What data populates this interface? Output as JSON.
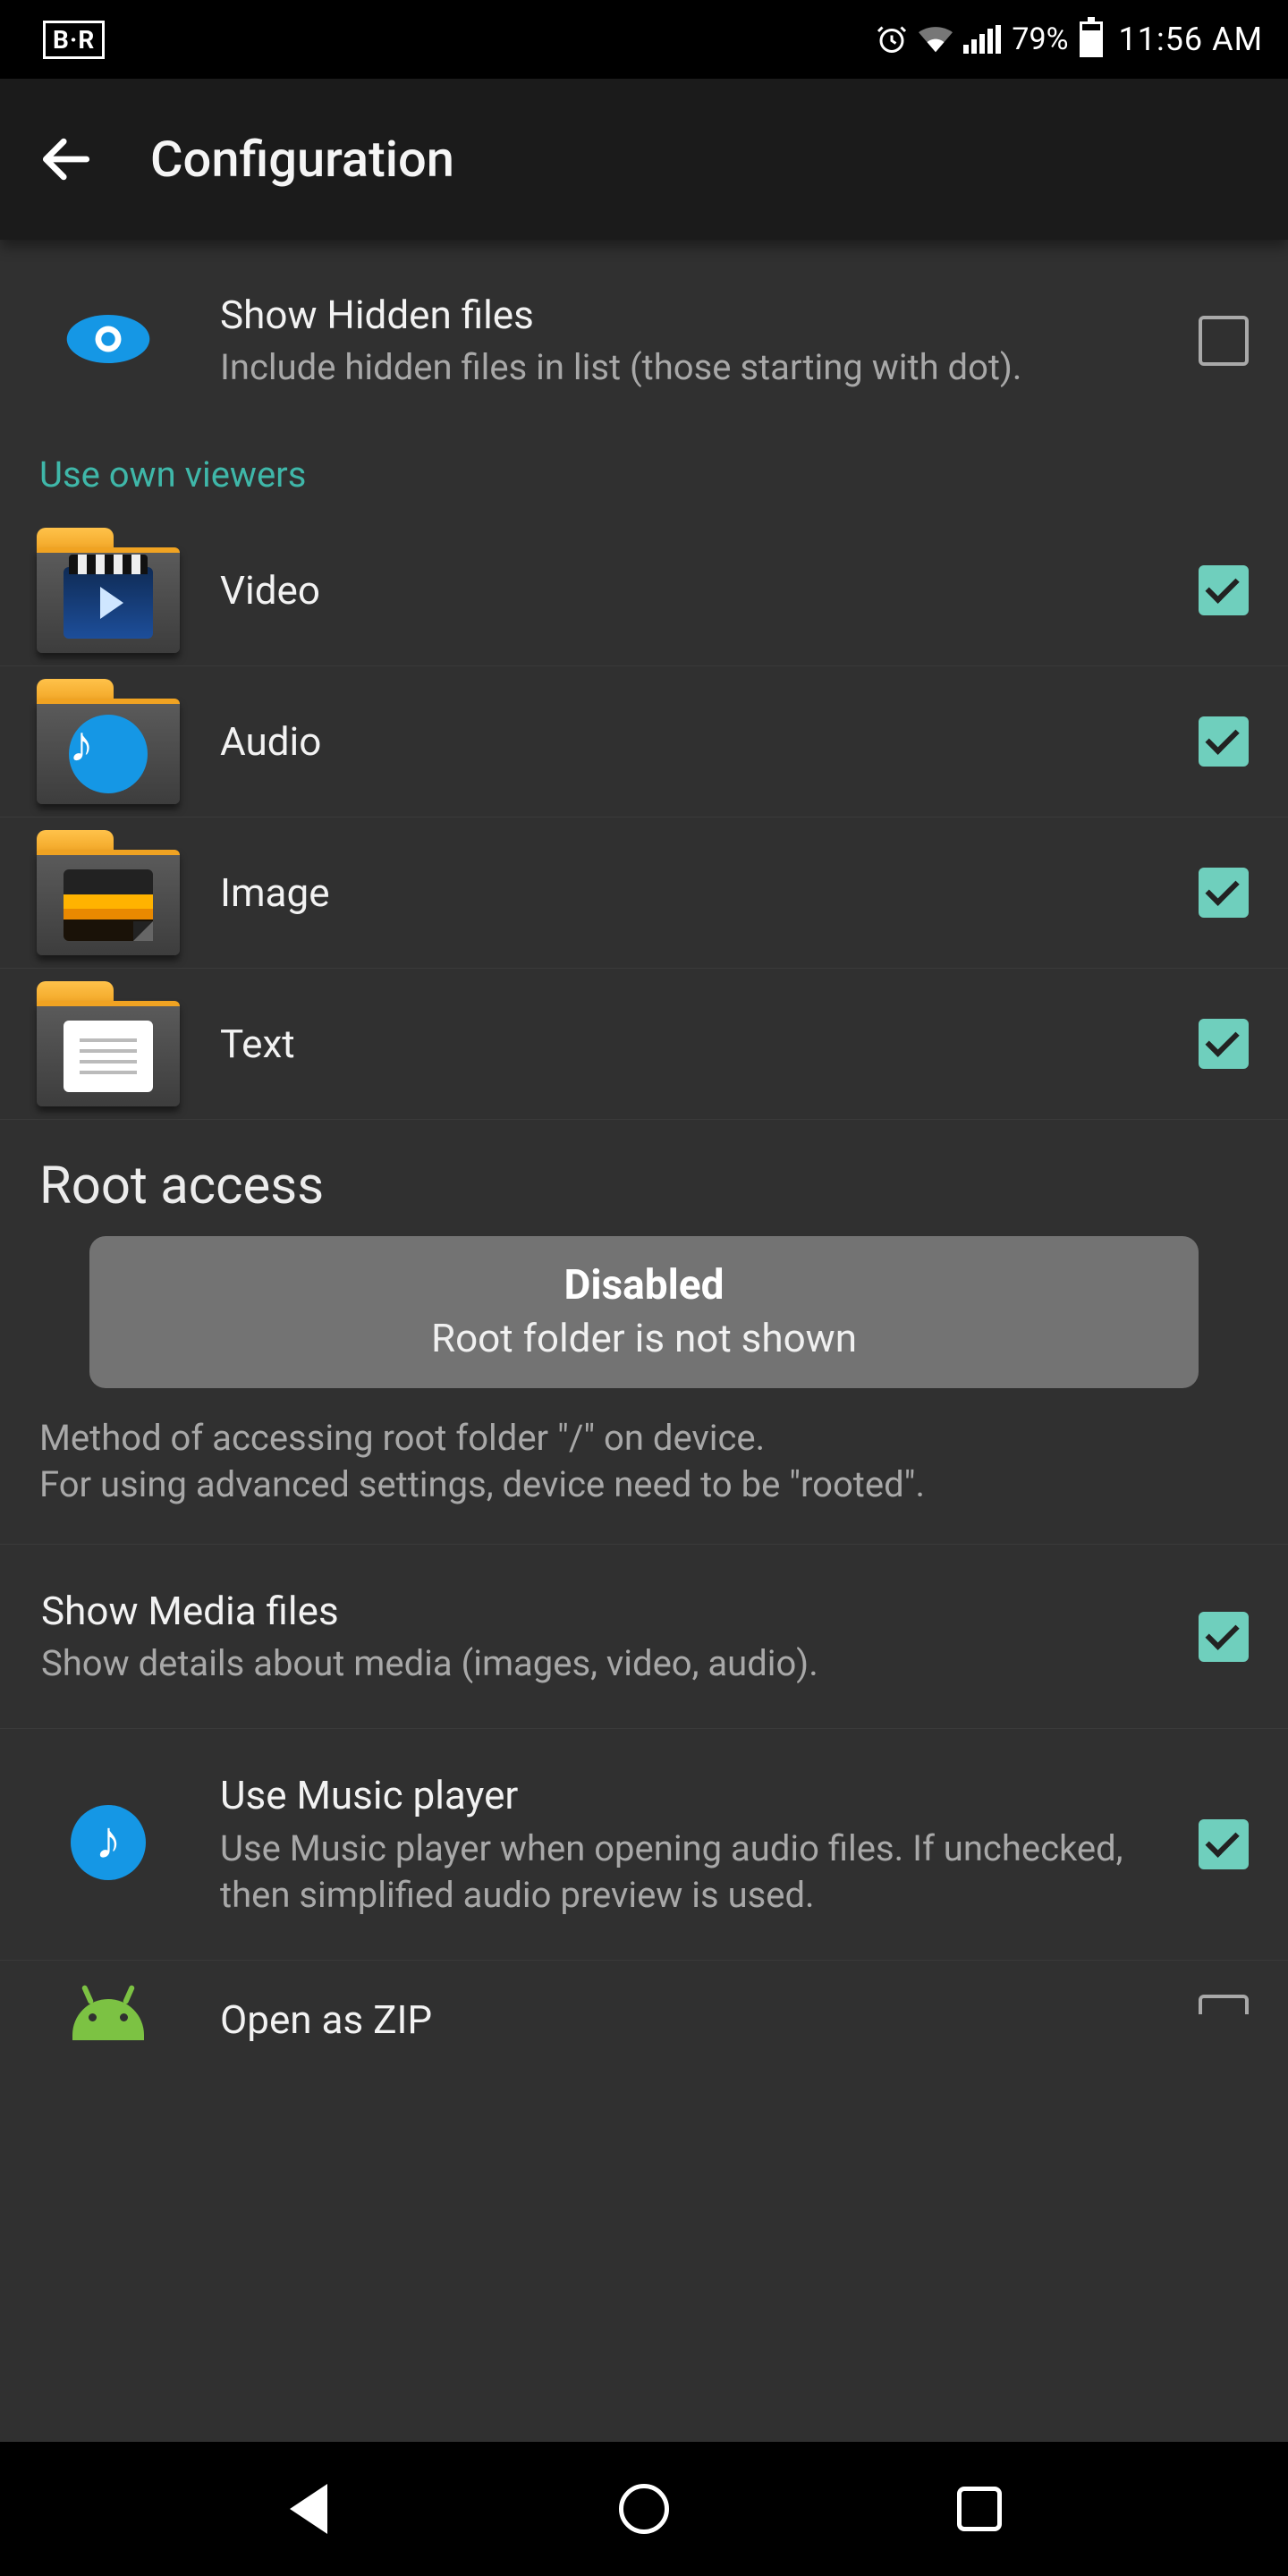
{
  "status": {
    "left_badge": "B·R",
    "battery_pct": "79%",
    "time": "11:56 AM"
  },
  "header": {
    "title": "Configuration"
  },
  "hidden_files": {
    "title": "Show Hidden files",
    "desc": "Include hidden files in list (those starting with dot).",
    "checked": false
  },
  "viewers_section_label": "Use own viewers",
  "viewers": [
    {
      "label": "Video",
      "icon": "video",
      "checked": true
    },
    {
      "label": "Audio",
      "icon": "audio",
      "checked": true
    },
    {
      "label": "Image",
      "icon": "image",
      "checked": true
    },
    {
      "label": "Text",
      "icon": "text",
      "checked": true
    }
  ],
  "root": {
    "heading": "Root access",
    "status_title": "Disabled",
    "status_sub": "Root folder is not shown",
    "desc_line1": "Method of accessing root folder \"/\" on device.",
    "desc_line2": "For using advanced settings, device need to be \"rooted\"."
  },
  "media": {
    "title": "Show Media files",
    "desc": "Show details about media (images, video, audio).",
    "checked": true
  },
  "music": {
    "title": "Use Music player",
    "desc": "Use Music player when opening audio files. If unchecked, then simplified audio preview is used.",
    "checked": true
  },
  "zip": {
    "title": "Open as ZIP",
    "checked": false
  }
}
